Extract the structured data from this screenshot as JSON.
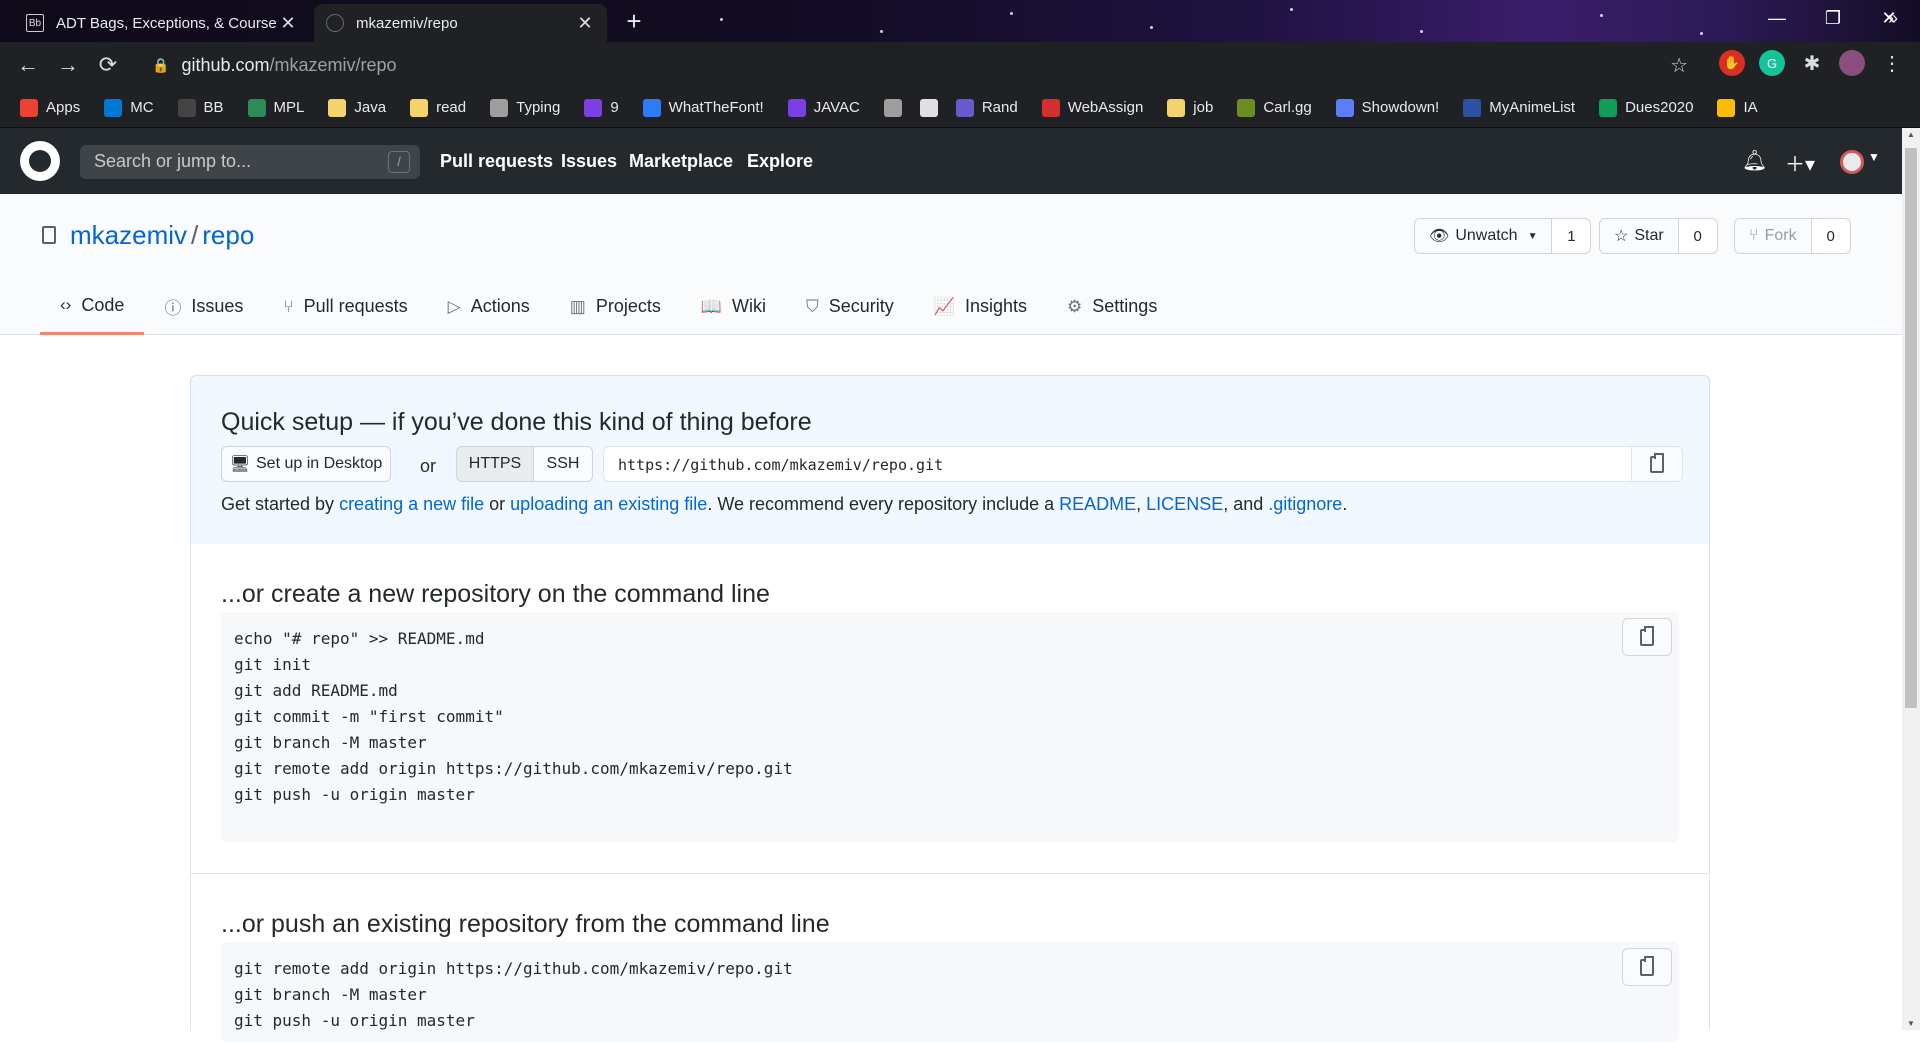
{
  "browser": {
    "tabs": [
      {
        "title": "ADT Bags, Exceptions, & Course",
        "favicon": "Bb",
        "active": false
      },
      {
        "title": "mkazemiv/repo",
        "favicon": "github-icon",
        "active": true
      }
    ],
    "address": {
      "host": "github.com",
      "path": "/mkazemiv/repo"
    },
    "bookmarks": [
      {
        "label": "Apps",
        "icon": "apps-grid-icon",
        "color": "#ea4335"
      },
      {
        "label": "MC",
        "icon": "outlook-icon",
        "color": "#0078d4"
      },
      {
        "label": "BB",
        "icon": "blackboard-icon",
        "color": "#444444"
      },
      {
        "label": "MPL",
        "icon": "mpl-icon",
        "color": "#2e8b57"
      },
      {
        "label": "Java",
        "icon": "folder-icon",
        "color": "#f5d36b"
      },
      {
        "label": "read",
        "icon": "folder-icon",
        "color": "#f5d36b"
      },
      {
        "label": "Typing",
        "icon": "typing-icon",
        "color": "#9e9e9e"
      },
      {
        "label": "9",
        "icon": "play-icon",
        "color": "#7b3fe4"
      },
      {
        "label": "WhatTheFont!",
        "icon": "whatthefont-icon",
        "color": "#2d7cf6"
      },
      {
        "label": "JAVAC",
        "icon": "bolt-icon",
        "color": "#7b3fe4"
      },
      {
        "label": "",
        "icon": "clock-icon",
        "color": "#9e9e9e"
      },
      {
        "label": "",
        "icon": "circle-icon",
        "color": "#e0e0e0"
      },
      {
        "label": "Rand",
        "icon": "rand-icon",
        "color": "#6a5acd"
      },
      {
        "label": "WebAssign",
        "icon": "webassign-icon",
        "color": "#d32f2f"
      },
      {
        "label": "job",
        "icon": "folder-icon",
        "color": "#f5d36b"
      },
      {
        "label": "Carl.gg",
        "icon": "carl-icon",
        "color": "#6b8e23"
      },
      {
        "label": "Showdown!",
        "icon": "showdown-icon",
        "color": "#5c7cfa"
      },
      {
        "label": "MyAnimeList",
        "icon": "mal-icon",
        "color": "#2e51a2"
      },
      {
        "label": "Dues2020",
        "icon": "sheets-icon",
        "color": "#0f9d58"
      },
      {
        "label": "IA",
        "icon": "drive-icon",
        "color": "#fbbc04"
      }
    ],
    "bookmarks_more": "»"
  },
  "github": {
    "search_placeholder": "Search or jump to...",
    "search_key": "/",
    "nav": [
      "Pull requests",
      "Issues",
      "Marketplace",
      "Explore"
    ]
  },
  "repo": {
    "owner": "mkazemiv",
    "separator": "/",
    "name": "repo",
    "watch_label": "Unwatch",
    "watch_count": "1",
    "star_label": "Star",
    "star_count": "0",
    "fork_label": "Fork",
    "fork_count": "0",
    "tabs": [
      {
        "label": "Code",
        "icon": "code-icon",
        "glyph": "‹›"
      },
      {
        "label": "Issues",
        "icon": "issue-icon",
        "glyph": "ⓘ"
      },
      {
        "label": "Pull requests",
        "icon": "pull-request-icon",
        "glyph": "⑂"
      },
      {
        "label": "Actions",
        "icon": "play-circle-icon",
        "glyph": "▷"
      },
      {
        "label": "Projects",
        "icon": "project-icon",
        "glyph": "▥"
      },
      {
        "label": "Wiki",
        "icon": "book-icon",
        "glyph": "📖"
      },
      {
        "label": "Security",
        "icon": "shield-icon",
        "glyph": "⛉"
      },
      {
        "label": "Insights",
        "icon": "graph-icon",
        "glyph": "📈"
      },
      {
        "label": "Settings",
        "icon": "gear-icon",
        "glyph": "⚙"
      }
    ]
  },
  "setup": {
    "title": "Quick setup — if you’ve done this kind of thing before",
    "desktop_label": "Set up in Desktop",
    "or": "or",
    "https_label": "HTTPS",
    "ssh_label": "SSH",
    "url": "https://github.com/mkazemiv/repo.git",
    "getstarted": {
      "t1": "Get started by ",
      "link1": "creating a new file",
      "t2": " or ",
      "link2": "uploading an existing file",
      "t3": ". We recommend every repository include a ",
      "link3": "README",
      "t4": ", ",
      "link4": "LICENSE",
      "t5": ", and ",
      "link5": ".gitignore",
      "t6": "."
    }
  },
  "create_section": {
    "title": "...or create a new repository on the command line",
    "code": "echo \"# repo\" >> README.md\ngit init\ngit add README.md\ngit commit -m \"first commit\"\ngit branch -M master\ngit remote add origin https://github.com/mkazemiv/repo.git\ngit push -u origin master"
  },
  "push_section": {
    "title": "...or push an existing repository from the command line",
    "code": "git remote add origin https://github.com/mkazemiv/repo.git\ngit branch -M master\ngit push -u origin master"
  }
}
